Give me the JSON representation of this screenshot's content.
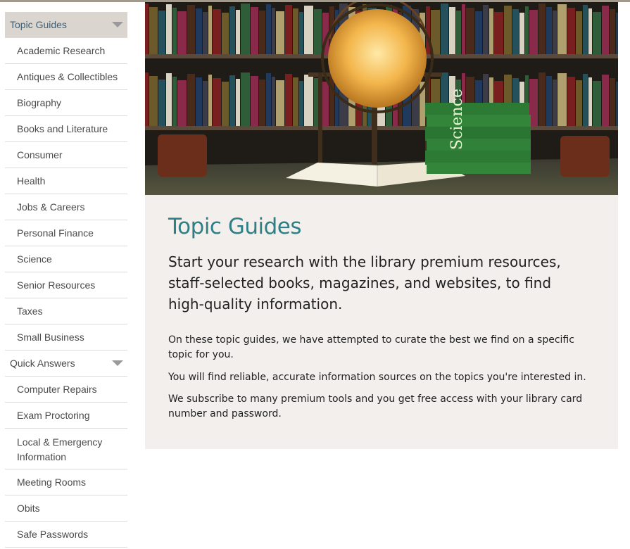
{
  "sidebar": {
    "topic_guides": {
      "label": "Topic Guides",
      "items": [
        "Academic Research",
        "Antiques & Collectibles",
        "Biography",
        "Books and Literature",
        "Consumer",
        "Health",
        "Jobs & Careers",
        "Personal Finance",
        "Science",
        "Senior Resources",
        "Taxes",
        "Small Business"
      ]
    },
    "quick_answers": {
      "label": "Quick Answers",
      "items": [
        "Computer Repairs",
        "Exam Proctoring",
        "Local & Emergency Information",
        "Meeting Rooms",
        "Obits",
        "Safe Passwords"
      ]
    }
  },
  "hero": {
    "book_spine_text": "Science"
  },
  "main": {
    "title": "Topic Guides",
    "lead": "Start your research with the library premium resources, staff-selected books, magazines, and websites, to find high-quality information.",
    "paragraphs": [
      "On these topic guides, we have attempted to curate the best we find on a specific topic for you.",
      "You will find reliable, accurate information sources on the topics you're interested in.",
      "We subscribe to many premium tools and you get free access with your library card number and password."
    ]
  },
  "colors": {
    "accent_title": "#2f7f86",
    "active_nav_bg": "#dad6cf",
    "panel_bg": "#f2efec"
  }
}
